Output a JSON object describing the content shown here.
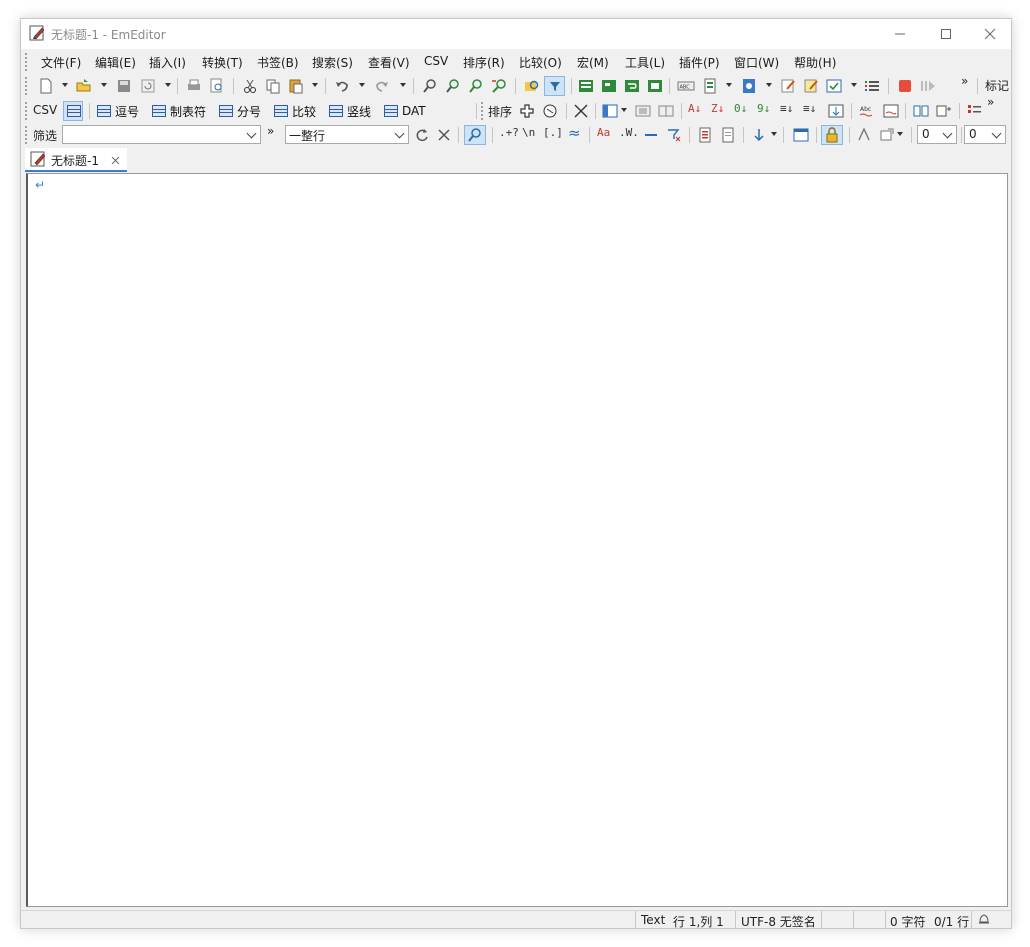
{
  "window": {
    "title": "无标题-1 - EmEditor"
  },
  "menu": [
    "文件(F)",
    "编辑(E)",
    "插入(I)",
    "转换(T)",
    "书签(B)",
    "搜索(S)",
    "查看(V)",
    "CSV",
    "排序(R)",
    "比较(O)",
    "宏(M)",
    "工具(L)",
    "插件(P)",
    "窗口(W)",
    "帮助(H)"
  ],
  "toolbar1": {
    "overflow": "»",
    "marker_label": "标记"
  },
  "toolbar2": {
    "csv_label": "CSV",
    "csv_modes": [
      "逗号",
      "制表符",
      "分号",
      "比较",
      "竖线",
      "DAT"
    ],
    "sort_label": "排序",
    "overflow": "»"
  },
  "toolbar3": {
    "filter_label": "筛选",
    "filter_value": "",
    "overflow": "»",
    "mode_value": "一整行",
    "regex_btn": ".+?",
    "newline_btn": "\\n",
    "bracket_btn": "[.]",
    "case_btn": "Aa",
    "word_btn": ".W.",
    "num1": "0",
    "num2": "0"
  },
  "tabs": [
    {
      "label": "无标题-1"
    }
  ],
  "editor": {
    "content": "",
    "eof_mark": "↵"
  },
  "status": {
    "mode": "Text",
    "position": "行 1,列 1",
    "encoding": "UTF-8 无签名",
    "chars": "0 字符",
    "lines": "0/1 行"
  },
  "colors": {
    "accent": "#3c7bd0",
    "tab_underline": "#3c7bd0",
    "eof": "#3a86c8"
  }
}
